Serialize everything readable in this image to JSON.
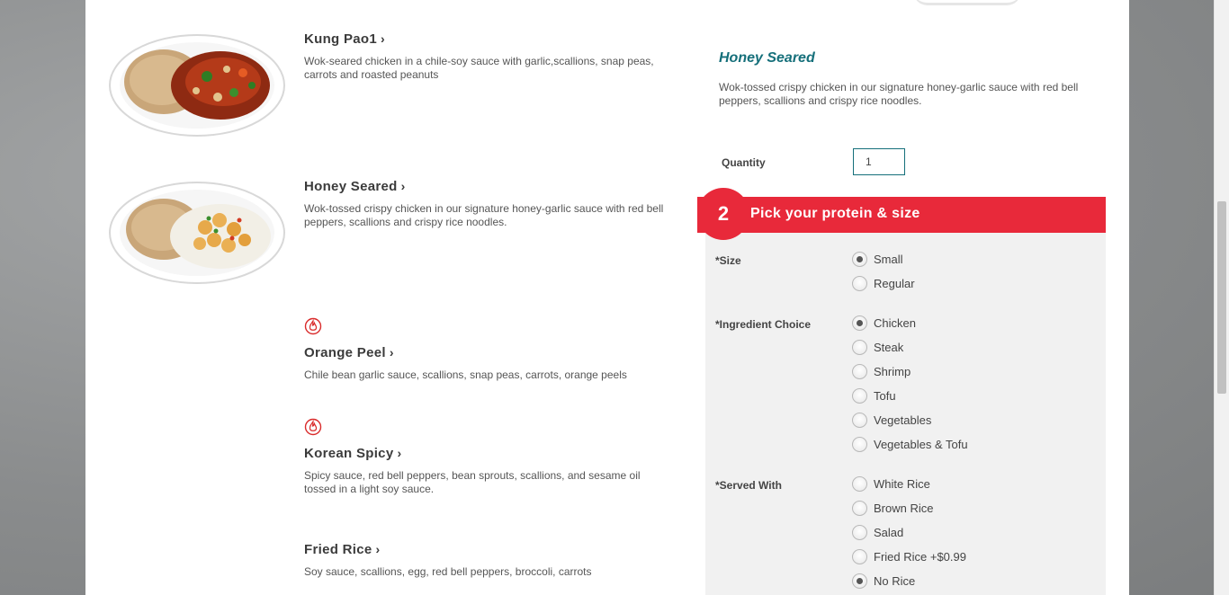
{
  "menu_items": [
    {
      "title": "Kung Pao1",
      "desc": "Wok-seared chicken in a chile-soy sauce with garlic,scallions, snap peas, carrots and roasted peanuts",
      "chevron": "›",
      "spicy": false
    },
    {
      "title": "Honey Seared",
      "desc": "Wok-tossed crispy chicken in our signature honey-garlic sauce with red bell peppers, scallions and crispy rice noodles.",
      "chevron": "›",
      "spicy": false
    },
    {
      "title": "Orange Peel",
      "desc": "Chile bean garlic sauce, scallions, snap peas, carrots, orange peels",
      "chevron": "›",
      "spicy": true
    },
    {
      "title": "Korean Spicy",
      "desc": "Spicy sauce, red bell peppers, bean sprouts, scallions, and sesame oil tossed in a light soy sauce.",
      "chevron": "›",
      "spicy": true
    },
    {
      "title": "Fried Rice",
      "desc": "Soy sauce, scallions, egg, red bell peppers, broccoli, carrots",
      "chevron": "›",
      "spicy": false
    }
  ],
  "detail": {
    "title": "Honey Seared",
    "desc": "Wok-tossed crispy chicken in our signature honey-garlic sauce with red bell peppers, scallions and crispy rice noodles.",
    "quantity_label": "Quantity",
    "quantity_value": "1"
  },
  "step": {
    "number": "2",
    "label": "Pick your protein & size"
  },
  "options": {
    "size": {
      "label": "*Size",
      "choices": [
        "Small",
        "Regular"
      ],
      "selected": "Small"
    },
    "ingredient": {
      "label": "*Ingredient Choice",
      "choices": [
        "Chicken",
        "Steak",
        "Shrimp",
        "Tofu",
        "Vegetables",
        "Vegetables & Tofu"
      ],
      "selected": "Chicken"
    },
    "served_with": {
      "label": "*Served With",
      "choices": [
        "White Rice",
        "Brown Rice",
        "Salad",
        "Fried Rice +$0.99",
        "No Rice"
      ],
      "selected": "No Rice"
    }
  },
  "colors": {
    "accent_red": "#e8293a",
    "accent_teal": "#156f7a",
    "spicy_icon": "#d92b2b"
  },
  "icons": {
    "spicy": "chili-flame-icon",
    "chevron": "chevron-right-icon"
  }
}
